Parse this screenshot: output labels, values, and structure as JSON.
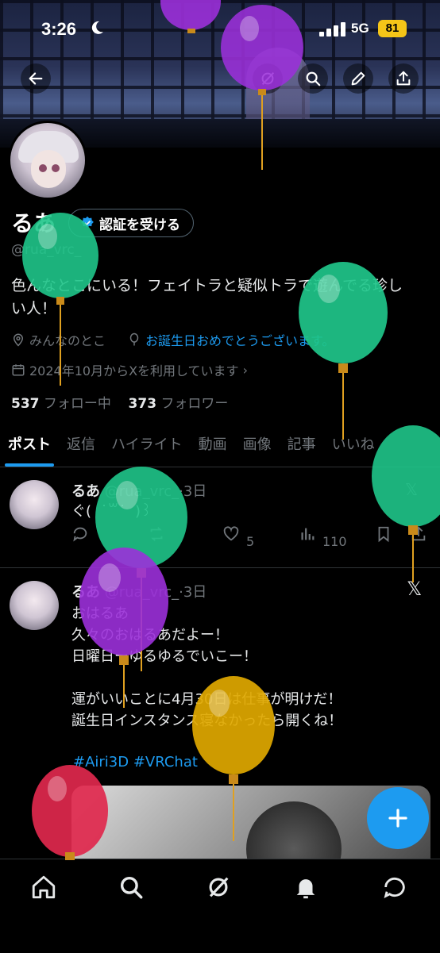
{
  "status_bar": {
    "time": "3:26",
    "network": "5G",
    "battery": "81"
  },
  "profile": {
    "display_name": "るあ",
    "verify_button": "認証を受ける",
    "handle": "@rua_vrc_",
    "bio_line1": "色んなとこにいる！フェイトラと疑似トラで遊んでる珍し",
    "bio_line2": "い人！",
    "location": "みんなのとこ",
    "birthday_text": "お誕生日おめでとうございます。",
    "joined": "2024年10月からXを利用しています",
    "following_count": "537",
    "following_label": "フォロー中",
    "followers_count": "373",
    "followers_label": "フォロワー"
  },
  "tabs": [
    {
      "label": "ポスト",
      "active": true
    },
    {
      "label": "返信"
    },
    {
      "label": "ハイライト"
    },
    {
      "label": "動画"
    },
    {
      "label": "画像"
    },
    {
      "label": "記事"
    },
    {
      "label": "いいね"
    }
  ],
  "posts": [
    {
      "author": "るあ",
      "handle": "@rua_vrc_",
      "time": "3日",
      "text": "ぐ(  ˙꒳˙  )꒱",
      "likes": "5",
      "views": "110"
    },
    {
      "author": "るあ",
      "handle": "@rua_vrc_",
      "time": "3日",
      "text": "おはるあ\n久々のおはるあだよー！\n日曜日ーゆるゆるでいこー！\n\n運がいいことに4月30日は仕事が明けだ！\n誕生日インスタンス寝なかったら開くね！",
      "hashtags": "#Airi3D  #VRChat"
    }
  ],
  "colors": {
    "accent": "#1d9bf0",
    "balloon_purple": "#9b30d9",
    "balloon_green": "#1fc58a",
    "balloon_yellow": "#e0a800",
    "balloon_red": "#e0284d"
  }
}
